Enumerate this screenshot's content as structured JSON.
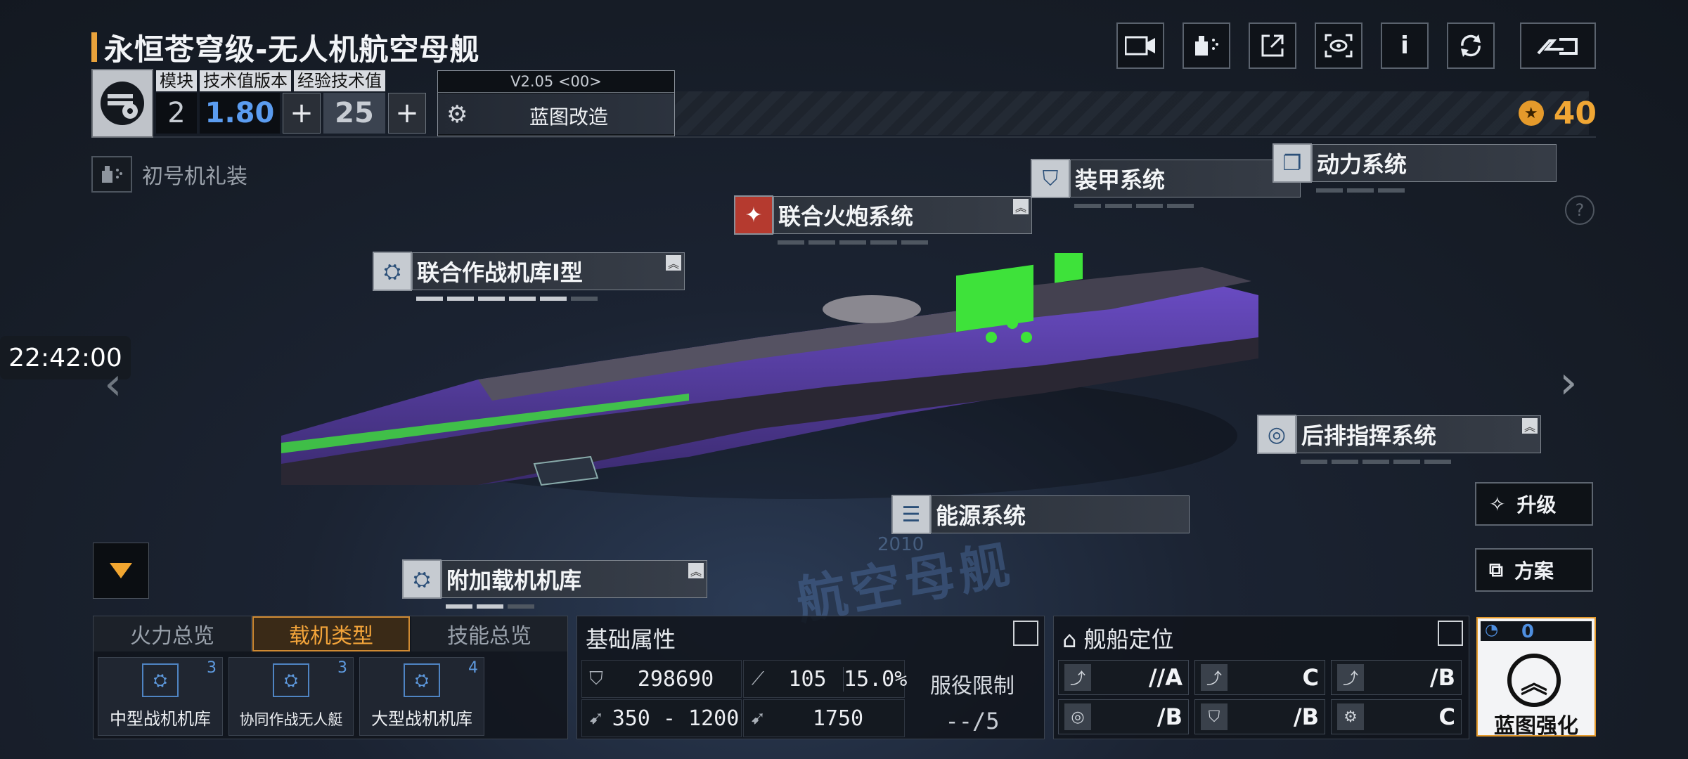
{
  "title": "永恒苍穹级-无人机航空母舰",
  "top_icons": [
    "video-icon",
    "spray-icon",
    "share-icon",
    "view-icon",
    "info-icon",
    "refresh-icon",
    "back-icon"
  ],
  "stats": {
    "headers": [
      "模块",
      "技术值版本",
      "经验技术值"
    ],
    "module": "2",
    "tech_version": "1.80",
    "exp_tech": "25"
  },
  "version": "V2.05 <00>",
  "remodel_label": "蓝图改造",
  "currency": {
    "value": "40",
    "color": "#f0a634"
  },
  "skin_label": "初号机礼装",
  "clock": "22:42:00",
  "systems": {
    "hangar1": "联合作战机库I型",
    "cannon": "联合火炮系统",
    "armor": "装甲系统",
    "power": "动力系统",
    "command": "后排指挥系统",
    "energy": "能源系统",
    "extra_hangar": "附加载机机库"
  },
  "side_buttons": {
    "upgrade": "升级",
    "plan": "方案"
  },
  "watermark": "航空母舰",
  "watermark_year": "2010",
  "carrier": {
    "tabs": [
      "火力总览",
      "载机类型",
      "技能总览"
    ],
    "active_tab": 1,
    "hangars": [
      {
        "label": "中型战机机库",
        "count": "3"
      },
      {
        "label": "协同作战无人艇",
        "count": "3"
      },
      {
        "label": "大型战机机库",
        "count": "4"
      }
    ]
  },
  "attributes": {
    "title": "基础属性",
    "hp": "298690",
    "armor": "105",
    "armor_pct": "15.0%",
    "speed_range": "350 - 1200",
    "warp": "1750",
    "service_label": "服役限制",
    "service_value": "--/5"
  },
  "role": {
    "title": "舰船定位",
    "grades": [
      "//A",
      "C",
      "/B",
      "/B",
      "/B",
      "C"
    ]
  },
  "enhance": {
    "count": "0",
    "label": "蓝图强化"
  }
}
